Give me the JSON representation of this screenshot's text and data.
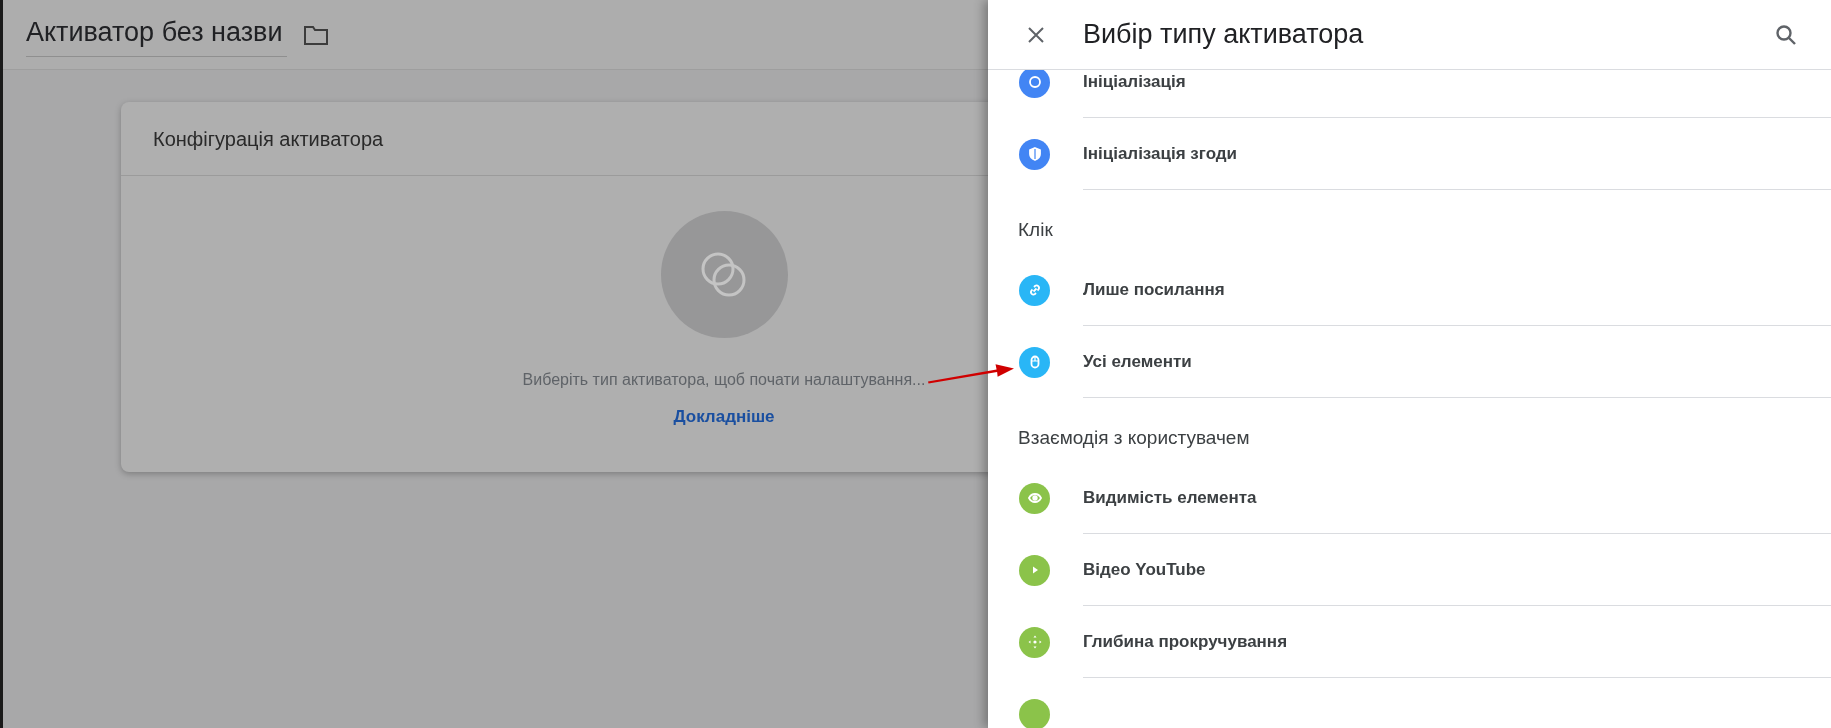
{
  "page": {
    "title": "Активатор без назви"
  },
  "card": {
    "title": "Конфігурація активатора",
    "hint": "Виберіть тип активатора, щоб почати налаштування...",
    "link": "Докладніше"
  },
  "panel": {
    "title": "Вибір типу активатора",
    "entries": [
      {
        "kind": "item",
        "label": "Ініціалізація",
        "color": "#4285f4"
      },
      {
        "kind": "item",
        "label": "Ініціалізація згоди",
        "color": "#4285f4"
      },
      {
        "kind": "header",
        "label": "Клік"
      },
      {
        "kind": "item",
        "label": "Лише посилання",
        "color": "#29b6f6"
      },
      {
        "kind": "item",
        "label": "Усі елементи",
        "color": "#29b6f6"
      },
      {
        "kind": "header",
        "label": "Взаємодія з користувачем"
      },
      {
        "kind": "item",
        "label": "Видимість елемента",
        "color": "#8bc34a"
      },
      {
        "kind": "item",
        "label": "Відео YouTube",
        "color": "#8bc34a"
      },
      {
        "kind": "item",
        "label": "Глибина прокручування",
        "color": "#8bc34a"
      },
      {
        "kind": "item",
        "color": "#8bc34a"
      }
    ]
  }
}
